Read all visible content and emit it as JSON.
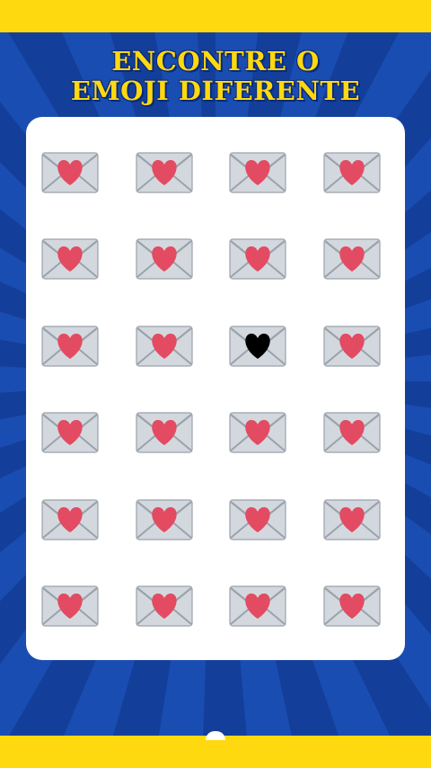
{
  "title": {
    "line1": "ENCONTRE O",
    "line2": "EMOJI DIFERENTE"
  },
  "colors": {
    "band": "#ffd90f",
    "background": "#1747a6",
    "board": "#ffffff",
    "heart": "#e34b62",
    "odd_heart": "#000000",
    "envelope": "#d3d8de",
    "envelope_edge": "#9aa2ab"
  },
  "grid": {
    "rows": 6,
    "columns": 4,
    "emoji": "love-letter-icon",
    "odd_emoji": "love-letter-black-heart-icon",
    "odd_position": {
      "row": 3,
      "column": 3
    }
  }
}
